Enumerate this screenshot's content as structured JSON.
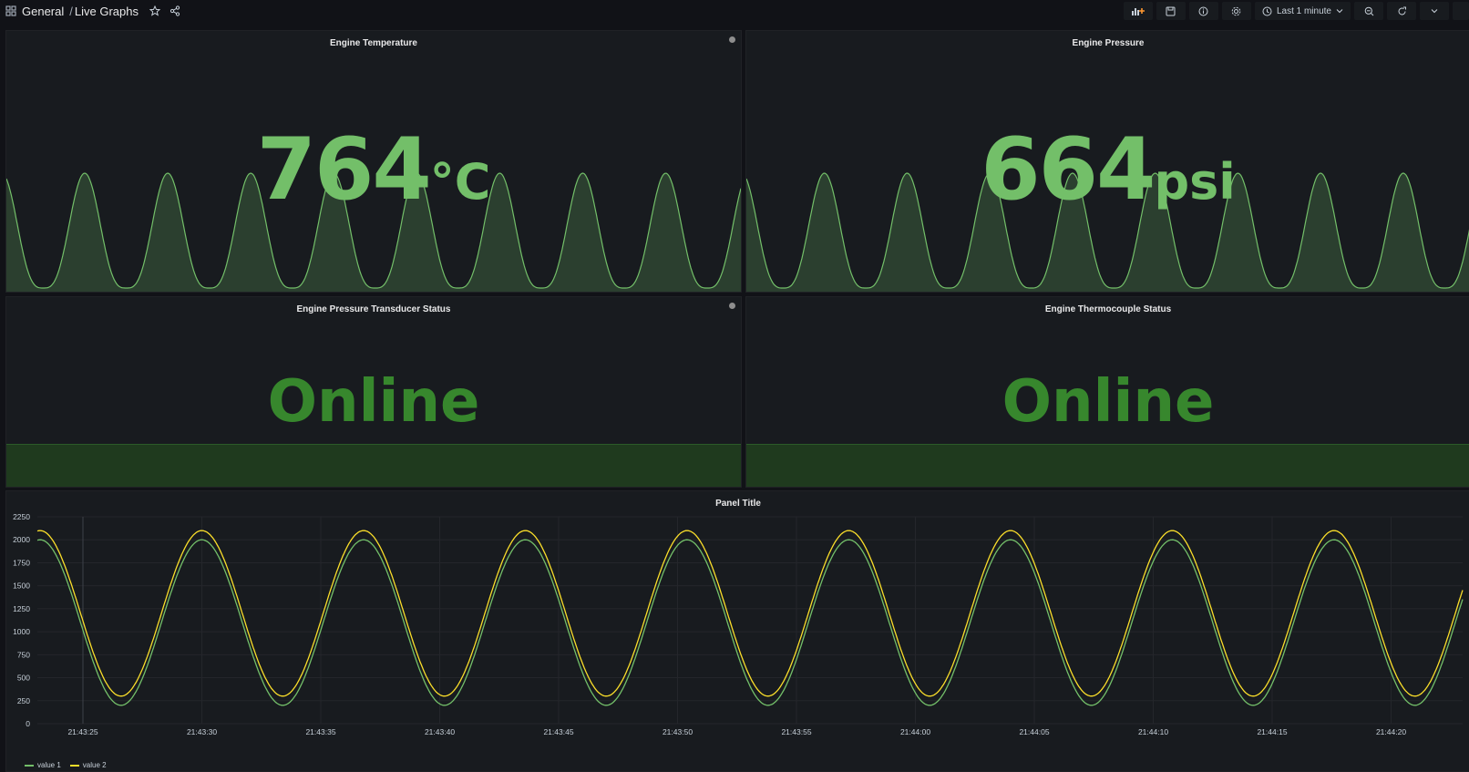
{
  "breadcrumb": {
    "folder": "General",
    "separator": "/",
    "dashboard": "Live Graphs"
  },
  "toolbar": {
    "time_range": "Last 1 minute"
  },
  "icons": {
    "dashboards": "grid-icon",
    "star": "star-icon",
    "share": "share-icon",
    "add_panel": "add-panel-icon",
    "save": "save-icon",
    "info": "info-icon",
    "settings": "gear-icon",
    "clock": "clock-icon",
    "zoom_out": "zoom-out-icon",
    "refresh": "refresh-icon",
    "dropdown": "chevron-down-icon"
  },
  "colors": {
    "green": "#73bf69",
    "dark_green": "#37872d",
    "yellow": "#fade2a",
    "bg": "#111217",
    "panel": "#181b1f"
  },
  "panels": {
    "temperature": {
      "title": "Engine Temperature",
      "value": "764",
      "unit": "°C"
    },
    "pressure": {
      "title": "Engine Pressure",
      "value": "664",
      "unit": "psi"
    },
    "transducer": {
      "title": "Engine Pressure Transducer Status",
      "status": "Online"
    },
    "thermocouple": {
      "title": "Engine Thermocouple Status",
      "status": "Online"
    },
    "graph": {
      "title": "Panel Title"
    }
  },
  "chart_data": {
    "type": "line",
    "title": "Panel Title",
    "xlabel": "",
    "ylabel": "",
    "ylim": [
      0,
      2250
    ],
    "yticks": [
      0,
      250,
      500,
      750,
      1000,
      1250,
      1500,
      1750,
      2000,
      2250
    ],
    "xticks": [
      "21:43:25",
      "21:43:30",
      "21:43:35",
      "21:43:40",
      "21:43:45",
      "21:43:50",
      "21:43:55",
      "21:44:00",
      "21:44:05",
      "21:44:10",
      "21:44:15",
      "21:44:20"
    ],
    "grid": true,
    "legend_position": "bottom-left",
    "series": [
      {
        "name": "value 1",
        "color": "#73bf69",
        "min": 200,
        "max": 2000,
        "period_s": 6.8
      },
      {
        "name": "value 2",
        "color": "#fade2a",
        "min": 300,
        "max": 2100,
        "period_s": 6.8
      }
    ]
  }
}
